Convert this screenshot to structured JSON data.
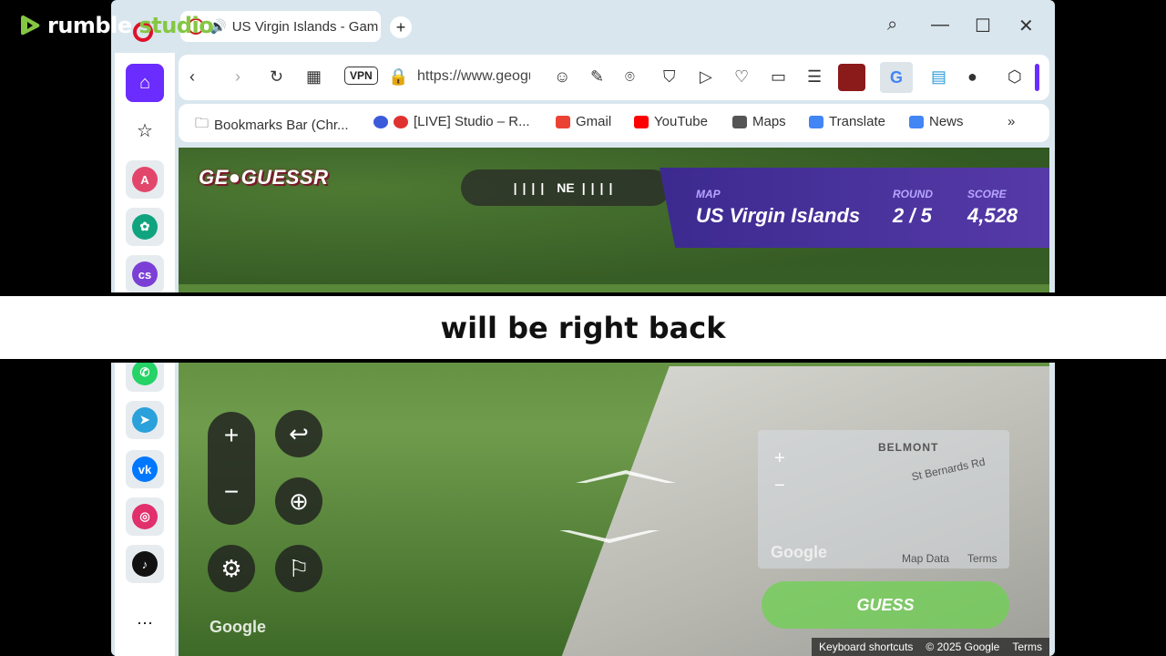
{
  "rumble": {
    "brand": "rumble",
    "studio": "studio"
  },
  "tab": {
    "title": "US Virgin Islands - Game"
  },
  "toolbar": {
    "vpn": "VPN",
    "url": "https://www.geoguessr.com"
  },
  "bookmarks": [
    {
      "label": "Bookmarks Bar (Chr..."
    },
    {
      "label": "[LIVE] Studio – R..."
    },
    {
      "label": "Gmail"
    },
    {
      "label": "YouTube"
    },
    {
      "label": "Maps"
    },
    {
      "label": "Translate"
    },
    {
      "label": "News"
    }
  ],
  "game": {
    "logo": "GE●GUESSR",
    "compass": "NE",
    "map_label": "MAP",
    "map_value": "US Virgin Islands",
    "round_label": "ROUND",
    "round_value": "2 / 5",
    "score_label": "SCORE",
    "score_value": "4,528",
    "minimap_place": "BELMONT",
    "minimap_road": "St Bernards Rd",
    "minimap_google": "Google",
    "minimap_data": "Map Data",
    "minimap_terms": "Terms",
    "guess": "GUESS",
    "google_watermark": "Google",
    "footer_shortcuts": "Keyboard shortcuts",
    "footer_copy": "© 2025 Google",
    "footer_terms": "Terms"
  },
  "banner": {
    "text": "will be right back"
  },
  "colors": {
    "accent": "#6b2cff",
    "status_bg": "#3c2a8f",
    "guess": "#6ed250",
    "rumble_green": "#85c742"
  }
}
